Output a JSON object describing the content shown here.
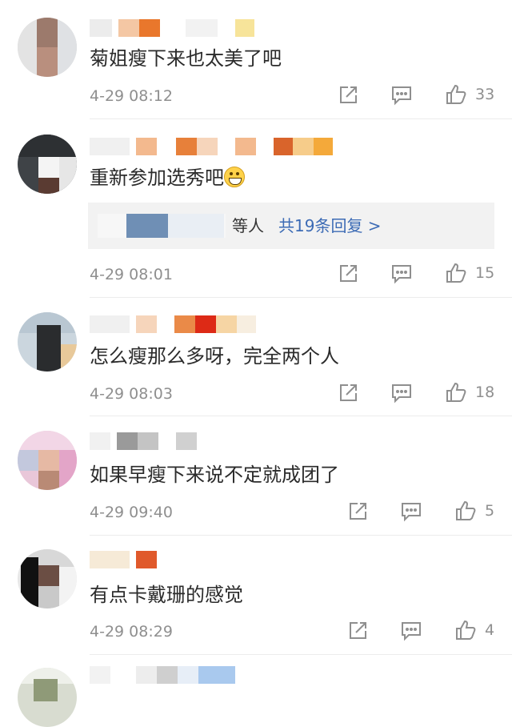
{
  "comments": [
    {
      "text": "菊姐瘦下来也太美了吧",
      "time": "4-29 08:12",
      "likes": "33"
    },
    {
      "text": "重新参加选秀吧",
      "emoji": "grinning-face",
      "time": "4-29 08:01",
      "likes": "15",
      "replies": {
        "suffix": "等人",
        "link": "共19条回复 >"
      }
    },
    {
      "text": "怎么瘦那么多呀，完全两个人",
      "time": "4-29 08:03",
      "likes": "18"
    },
    {
      "text": "如果早瘦下来说不定就成团了",
      "time": "4-29 09:40",
      "likes": "5"
    },
    {
      "text": "有点卡戴珊的感觉",
      "time": "4-29 08:29",
      "likes": "4"
    }
  ],
  "colors": {
    "link": "#3c6bb5",
    "meta": "#8f8f8f",
    "text": "#2b2b2b"
  },
  "icons": [
    "share-icon",
    "comment-icon",
    "thumbs-up-icon"
  ]
}
